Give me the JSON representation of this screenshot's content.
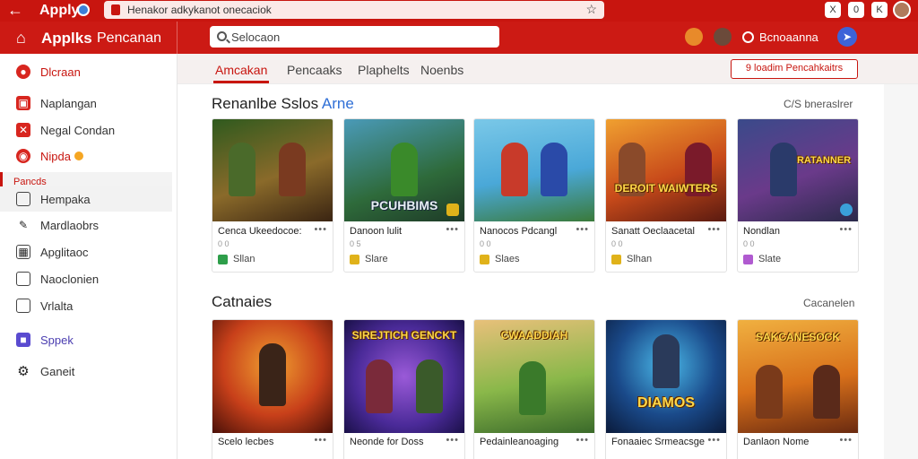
{
  "browser": {
    "tab_title": "Apply",
    "url": "Henakor adkykanot onecaciok",
    "buttons": [
      "X",
      "0",
      "K"
    ]
  },
  "header": {
    "brand": "Applks",
    "brand_sub": "Pencanan",
    "search_placeholder": "Selocaon",
    "user_name": "Bcnoaanna"
  },
  "sidebar": {
    "items": [
      {
        "label": "Dlcraan",
        "icon": "record-icon"
      },
      {
        "label": "Naplangan",
        "icon": "inbox-icon"
      },
      {
        "label": "Negal Condan",
        "icon": "mail-icon"
      },
      {
        "label": "Nipda",
        "icon": "target-icon"
      },
      {
        "label": "Hempaka",
        "icon": "square-icon"
      },
      {
        "label": "Mardlaobrs",
        "icon": "edit-icon"
      },
      {
        "label": "Apglitaoc",
        "icon": "grid-icon"
      },
      {
        "label": "Naoclonien",
        "icon": "window-icon"
      },
      {
        "label": "Vrlalta",
        "icon": "bookmark-icon"
      },
      {
        "label": "Sppek",
        "icon": "puzzle-icon"
      },
      {
        "label": "Ganeit",
        "icon": "gear-icon"
      }
    ],
    "section_label": "Pancds"
  },
  "tabs": {
    "items": [
      "Amcakan",
      "Pencaaks",
      "Plaphelts",
      "Noenbs"
    ],
    "action": "9 loadim Pencahkaitrs"
  },
  "section1": {
    "title": "Renanlbe Sslos",
    "title_accent": "Arne",
    "more": "C/S bneraslrer",
    "cards": [
      {
        "name": "Cenca Ukeedocoe:",
        "meta": "0 0",
        "tag": "Sllan",
        "tag_color": "#2e9e4a",
        "logo": ""
      },
      {
        "name": "Danoon lulit",
        "meta": "0 5",
        "tag": "Slare",
        "tag_color": "#e0b21a",
        "logo": "PCUHBIMS"
      },
      {
        "name": "Nanocos Pdcangl",
        "meta": "0 0",
        "tag": "Slaes",
        "tag_color": "#e0b21a",
        "logo": ""
      },
      {
        "name": "Sanatt Oeclaacetal",
        "meta": "0 0",
        "tag": "Slhan",
        "tag_color": "#e0b21a",
        "logo": "DEROIT WAIWTERS"
      },
      {
        "name": "Nondlan",
        "meta": "0 0",
        "tag": "Slate",
        "tag_color": "#b05ad0",
        "logo": "RATANNER"
      }
    ]
  },
  "section2": {
    "title": "Catnaies",
    "more": "Cacanelen",
    "cards": [
      {
        "name": "Scelo lecbes",
        "logo": ""
      },
      {
        "name": "Neonde for Doss",
        "logo": "SIREJTICH GENCKT"
      },
      {
        "name": "Pedainleanoaging",
        "logo": "CWAADDIAH"
      },
      {
        "name": "Fonaaiec Srmeacsge",
        "logo": "DIAMOS"
      },
      {
        "name": "Danlaon Nome",
        "logo": "SAKCANESOCK"
      }
    ]
  }
}
